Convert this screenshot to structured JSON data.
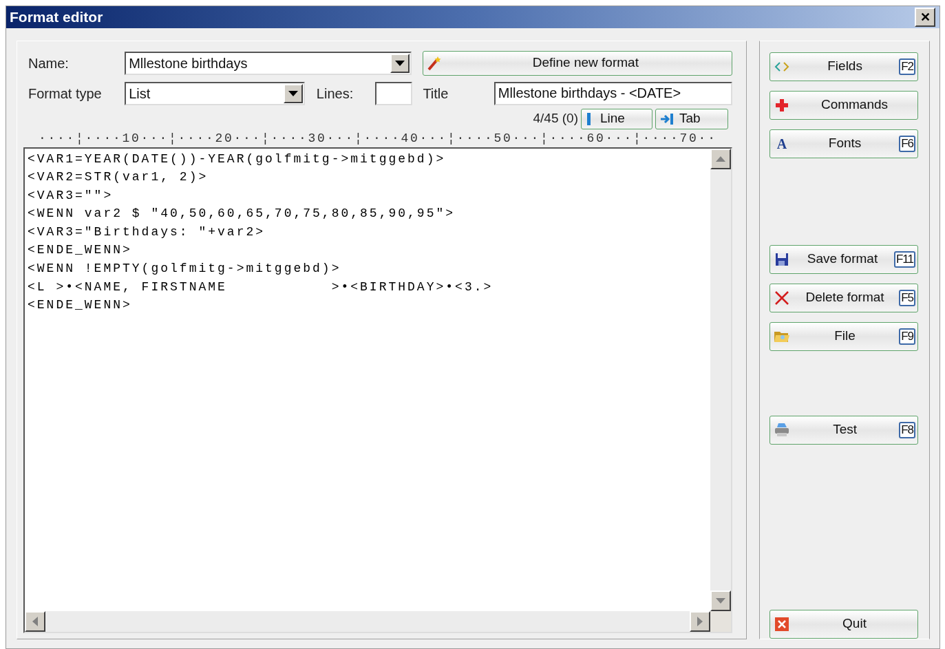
{
  "window": {
    "title": "Format editor",
    "close": "✕"
  },
  "form": {
    "name_label": "Name:",
    "name_value": "Mllestone birthdays",
    "format_type_label": "Format type",
    "format_type_value": "List",
    "lines_label": "Lines:",
    "title_label": "Title",
    "title_value": "Mllestone birthdays - <DATE>",
    "define_button": "Define new format",
    "position": "4/45 (0)",
    "line_button": "Line",
    "tab_button": "Tab"
  },
  "ruler": "····¦····10···¦····20···¦····30···¦····40···¦····50···¦····60···¦····70··",
  "editor_lines": [
    "<VAR1=YEAR(DATE())-YEAR(golfmitg->mitggebd)>",
    "<VAR2=STR(var1, 2)>",
    "<VAR3=\"\">",
    "<WENN var2 $ \"40,50,60,65,70,75,80,85,90,95\">",
    "<VAR3=\"Birthdays: \"+var2>",
    "<ENDE_WENN>",
    "<WENN !EMPTY(golfmitg->mitggebd)>",
    "<L >•<NAME, FIRSTNAME           >•<BIRTHDAY>•<3.>",
    "<ENDE_WENN>"
  ],
  "button_groups": [
    [
      {
        "label": "Fields",
        "key": "F2"
      },
      {
        "label": "Commands"
      },
      {
        "label": "Fonts",
        "key": "F6",
        "icon": "A"
      }
    ],
    [
      {
        "label": "Save format",
        "key": "F11"
      },
      {
        "label": "Delete format",
        "key": "F5"
      },
      {
        "label": "File",
        "key": "F9"
      }
    ],
    [
      {
        "label": "Test",
        "key": "F8"
      }
    ],
    [
      {
        "label": "Quit"
      }
    ]
  ]
}
